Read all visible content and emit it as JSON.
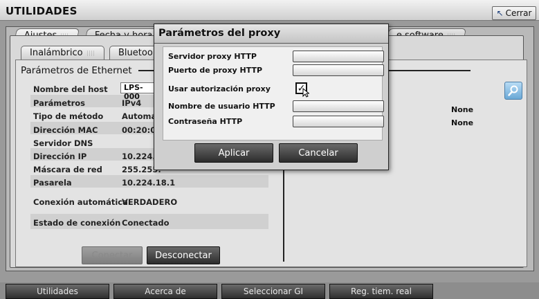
{
  "app": {
    "title": "UTILIDADES",
    "close_label": "Cerrar"
  },
  "tabs": [
    {
      "label": "Ajustes"
    },
    {
      "label": "Fecha y hora"
    },
    {
      "label": "e software"
    }
  ],
  "subtabs": [
    {
      "label": "Inalámbrico"
    },
    {
      "label": "Bluetoo"
    }
  ],
  "ethernet": {
    "section_title": "Parámetros de Ethernet",
    "fields": [
      {
        "label": "Nombre del host",
        "value": "LPS-000"
      },
      {
        "label": "Parámetros",
        "value": "IPv4"
      },
      {
        "label": "Tipo de método",
        "value": "Automát"
      },
      {
        "label": "Dirección MAC",
        "value": "00:20:00"
      },
      {
        "label": "Servidor DNS",
        "value": ""
      },
      {
        "label": "Dirección IP",
        "value": "10.224.1"
      },
      {
        "label": "Máscara de red",
        "value": "255.255."
      },
      {
        "label": "Pasarela",
        "value": "10.224.18.1"
      },
      {
        "label": "Conexión automática",
        "value": "VERDADERO"
      },
      {
        "label": "Estado de conexión",
        "value": "Conectado"
      }
    ],
    "right_values": [
      "None",
      "None"
    ],
    "connect_label": "Conectar",
    "disconnect_label": "Desconectar"
  },
  "proxy_dialog": {
    "title": "Parámetros del proxy",
    "fields": [
      {
        "label": "Servidor proxy HTTP",
        "value": ""
      },
      {
        "label": "Puerto de proxy HTTP",
        "value": ""
      },
      {
        "label": "Usar autorización proxy",
        "checked": true
      },
      {
        "label": "Nombre de usuario HTTP",
        "value": ""
      },
      {
        "label": "Contraseña HTTP",
        "value": ""
      }
    ],
    "apply_label": "Aplicar",
    "cancel_label": "Cancelar"
  },
  "bottom_nav": [
    {
      "label": "Utilidades"
    },
    {
      "label": "Acerca de"
    },
    {
      "label": "Seleccionar GI"
    },
    {
      "label": "Reg. tiem. real"
    }
  ],
  "icons": {
    "close": "arrow-pointer-icon",
    "search": "magnifier-icon",
    "check": "checkmark-icon"
  }
}
